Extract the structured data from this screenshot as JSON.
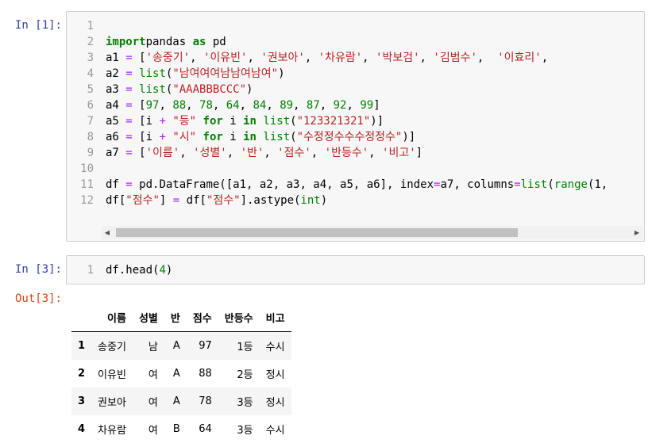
{
  "cell1": {
    "prompt": "In [1]:",
    "lines": [
      {
        "n": "1",
        "tokens": []
      },
      {
        "n": "2",
        "tokens": [
          [
            "kw",
            "import"
          ],
          [
            "",
            "pandas "
          ],
          [
            "kw",
            "as"
          ],
          [
            "",
            " pd"
          ]
        ]
      },
      {
        "n": "3",
        "tokens": [
          [
            "",
            "a1 "
          ],
          [
            "op",
            "="
          ],
          [
            "",
            " ["
          ],
          [
            "str",
            "'송중기'"
          ],
          [
            "",
            ", "
          ],
          [
            "str",
            "'이유빈'"
          ],
          [
            "",
            ", "
          ],
          [
            "str",
            "'권보아'"
          ],
          [
            "",
            ", "
          ],
          [
            "str",
            "'차유람'"
          ],
          [
            "",
            ", "
          ],
          [
            "str",
            "'박보검'"
          ],
          [
            "",
            ", "
          ],
          [
            "str",
            "'김범수'"
          ],
          [
            "",
            ",  "
          ],
          [
            "str",
            "'이효리'"
          ],
          [
            "",
            ","
          ]
        ]
      },
      {
        "n": "4",
        "tokens": [
          [
            "",
            "a2 "
          ],
          [
            "op",
            "="
          ],
          [
            "",
            " "
          ],
          [
            "bi",
            "list"
          ],
          [
            "",
            "("
          ],
          [
            "str",
            "\"남여여여남남여남여\""
          ],
          [
            "",
            ")"
          ]
        ]
      },
      {
        "n": "5",
        "tokens": [
          [
            "",
            "a3 "
          ],
          [
            "op",
            "="
          ],
          [
            "",
            " "
          ],
          [
            "bi",
            "list"
          ],
          [
            "",
            "("
          ],
          [
            "str",
            "\"AAABBBCCC\""
          ],
          [
            "",
            ")"
          ]
        ]
      },
      {
        "n": "6",
        "tokens": [
          [
            "",
            "a4 "
          ],
          [
            "op",
            "="
          ],
          [
            "",
            " ["
          ],
          [
            "num",
            "97"
          ],
          [
            "",
            ", "
          ],
          [
            "num",
            "88"
          ],
          [
            "",
            ", "
          ],
          [
            "num",
            "78"
          ],
          [
            "",
            ", "
          ],
          [
            "num",
            "64"
          ],
          [
            "",
            ", "
          ],
          [
            "num",
            "84"
          ],
          [
            "",
            ", "
          ],
          [
            "num",
            "89"
          ],
          [
            "",
            ", "
          ],
          [
            "num",
            "87"
          ],
          [
            "",
            ", "
          ],
          [
            "num",
            "92"
          ],
          [
            "",
            ", "
          ],
          [
            "num",
            "99"
          ],
          [
            "",
            "]"
          ]
        ]
      },
      {
        "n": "7",
        "tokens": [
          [
            "",
            "a5 "
          ],
          [
            "op",
            "="
          ],
          [
            "",
            " [i "
          ],
          [
            "op",
            "+"
          ],
          [
            "",
            " "
          ],
          [
            "str",
            "\"등\""
          ],
          [
            "",
            " "
          ],
          [
            "kw",
            "for"
          ],
          [
            "",
            " i "
          ],
          [
            "kw",
            "in"
          ],
          [
            "",
            " "
          ],
          [
            "bi",
            "list"
          ],
          [
            "",
            "("
          ],
          [
            "str",
            "\"123321321\""
          ],
          [
            "",
            ")]"
          ]
        ]
      },
      {
        "n": "8",
        "tokens": [
          [
            "",
            "a6 "
          ],
          [
            "op",
            "="
          ],
          [
            "",
            " [i "
          ],
          [
            "op",
            "+"
          ],
          [
            "",
            " "
          ],
          [
            "str",
            "\"시\""
          ],
          [
            "",
            " "
          ],
          [
            "kw",
            "for"
          ],
          [
            "",
            " i "
          ],
          [
            "kw",
            "in"
          ],
          [
            "",
            " "
          ],
          [
            "bi",
            "list"
          ],
          [
            "",
            "("
          ],
          [
            "str",
            "\"수정정수수수정정수\""
          ],
          [
            "",
            ")]"
          ]
        ]
      },
      {
        "n": "9",
        "tokens": [
          [
            "",
            "a7 "
          ],
          [
            "op",
            "="
          ],
          [
            "",
            " ["
          ],
          [
            "str",
            "'이름'"
          ],
          [
            "",
            ", "
          ],
          [
            "str",
            "'성별'"
          ],
          [
            "",
            ", "
          ],
          [
            "str",
            "'반'"
          ],
          [
            "",
            ", "
          ],
          [
            "str",
            "'점수'"
          ],
          [
            "",
            ", "
          ],
          [
            "str",
            "'반등수'"
          ],
          [
            "",
            ", "
          ],
          [
            "str",
            "'비고'"
          ],
          [
            "",
            "]"
          ]
        ]
      },
      {
        "n": "10",
        "tokens": []
      },
      {
        "n": "11",
        "tokens": [
          [
            "",
            "df "
          ],
          [
            "op",
            "="
          ],
          [
            "",
            " pd.DataFrame([a1, a2, a3, a4, a5, a6], index"
          ],
          [
            "op",
            "="
          ],
          [
            "",
            "a7, columns"
          ],
          [
            "op",
            "="
          ],
          [
            "bi",
            "list"
          ],
          [
            "",
            "("
          ],
          [
            "bi",
            "range"
          ],
          [
            "",
            "(1,"
          ]
        ]
      },
      {
        "n": "12",
        "tokens": [
          [
            "",
            "df["
          ],
          [
            "str",
            "\"점수\""
          ],
          [
            "",
            "] "
          ],
          [
            "op",
            "="
          ],
          [
            "",
            " df["
          ],
          [
            "str",
            "\"점수\""
          ],
          [
            "",
            "].astype("
          ],
          [
            "bi",
            "int"
          ],
          [
            "",
            ")"
          ]
        ]
      }
    ],
    "scrollbar": {
      "left_arrow": "◀",
      "right_arrow": "▶"
    }
  },
  "cell3": {
    "prompt": "In [3]:",
    "lines": [
      {
        "n": "1",
        "tokens": [
          [
            "",
            "df.head("
          ],
          [
            "num",
            "4"
          ],
          [
            "",
            ")"
          ]
        ]
      }
    ],
    "out_prompt": "Out[3]:"
  },
  "table": {
    "columns": [
      "",
      "이름",
      "성별",
      "반",
      "점수",
      "반등수",
      "비고"
    ],
    "rows": [
      [
        "1",
        "송중기",
        "남",
        "A",
        "97",
        "1등",
        "수시"
      ],
      [
        "2",
        "이유빈",
        "여",
        "A",
        "88",
        "2등",
        "정시"
      ],
      [
        "3",
        "권보아",
        "여",
        "A",
        "78",
        "3등",
        "정시"
      ],
      [
        "4",
        "차유람",
        "여",
        "B",
        "64",
        "3등",
        "수시"
      ]
    ]
  },
  "colors": {
    "in_prompt": "#303f9f",
    "out_prompt": "#d84315",
    "keyword": "#008000",
    "string": "#ba2121",
    "operator": "#aa22ff"
  }
}
